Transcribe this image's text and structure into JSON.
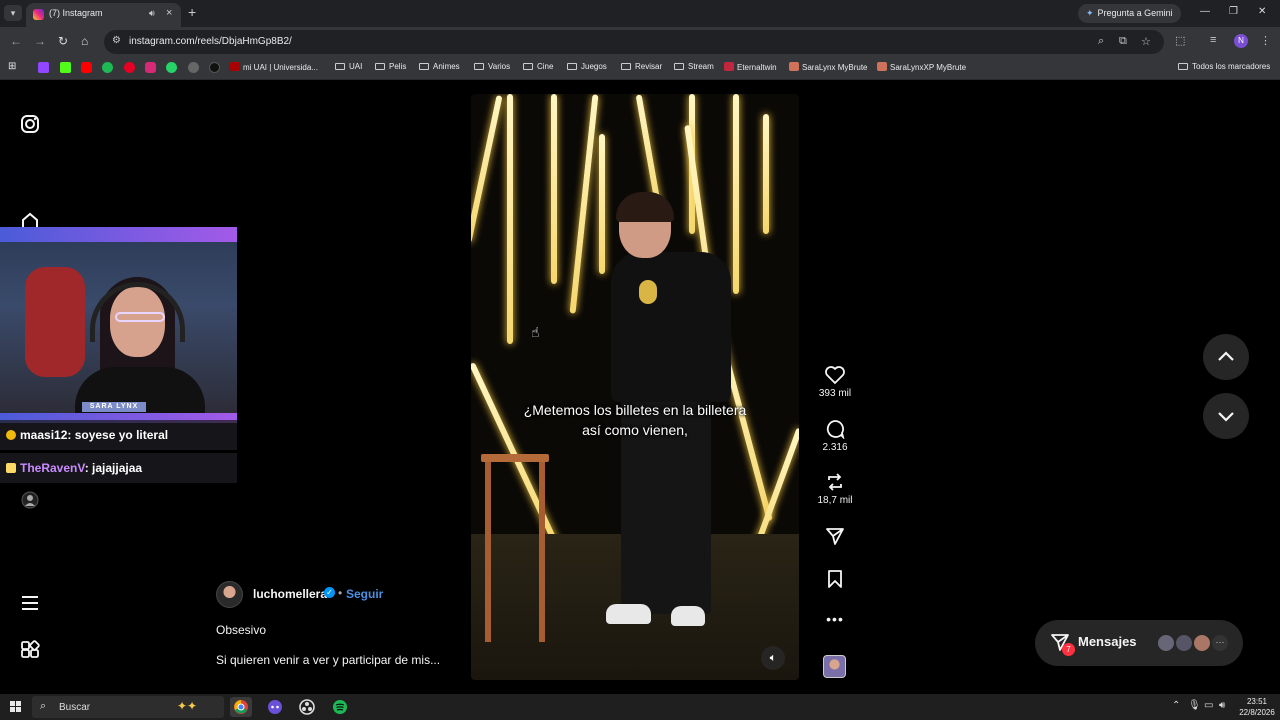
{
  "browser": {
    "tab_title": "(7) Instagram",
    "gemini_label": "Pregunta a Gemini",
    "url": "instagram.com/reels/DbjaHmGp8B2/",
    "bookmarks": [
      {
        "label": "mi UAI | Universida..."
      },
      {
        "label": "UAI"
      },
      {
        "label": "Pelis"
      },
      {
        "label": "Animes"
      },
      {
        "label": "Varios"
      },
      {
        "label": "Cine"
      },
      {
        "label": "Juegos"
      },
      {
        "label": "Revisar"
      },
      {
        "label": "Stream"
      },
      {
        "label": "Eternaltwin"
      },
      {
        "label": "SaraLynx MyBrute"
      },
      {
        "label": "SaraLynxXP MyBrute"
      }
    ],
    "all_bookmarks": "Todos los marcadores",
    "profile_letter": "N"
  },
  "overlay": {
    "streamer_tag": "SARA LYNX",
    "chat": [
      {
        "user": "maasi12",
        "message": ": soyese yo literal"
      },
      {
        "user": "TheRavenV",
        "message": ": jajajjajaa"
      }
    ]
  },
  "reel": {
    "subtitle_line1": "¿Metemos los billetes en la billetera",
    "subtitle_line2": "así como vienen,",
    "likes": "393 mil",
    "comments": "2.316",
    "reposts": "18,7 mil",
    "author": "luchomellera",
    "follow_label": "Seguir",
    "separator": "•",
    "caption_title": "Obsesivo",
    "caption_body": "Si quieren venir a ver y participar de mis..."
  },
  "messages": {
    "label": "Mensajes",
    "badge": "7"
  },
  "taskbar": {
    "search_label": "Buscar",
    "time": "23:51",
    "date": "22/8/2026"
  },
  "colors": {
    "instagram_bg": "#000000",
    "follow_blue": "#4a90e2",
    "verified_blue": "#0095f6",
    "notification_red": "#ff3040",
    "chrome_dark": "#202124"
  }
}
